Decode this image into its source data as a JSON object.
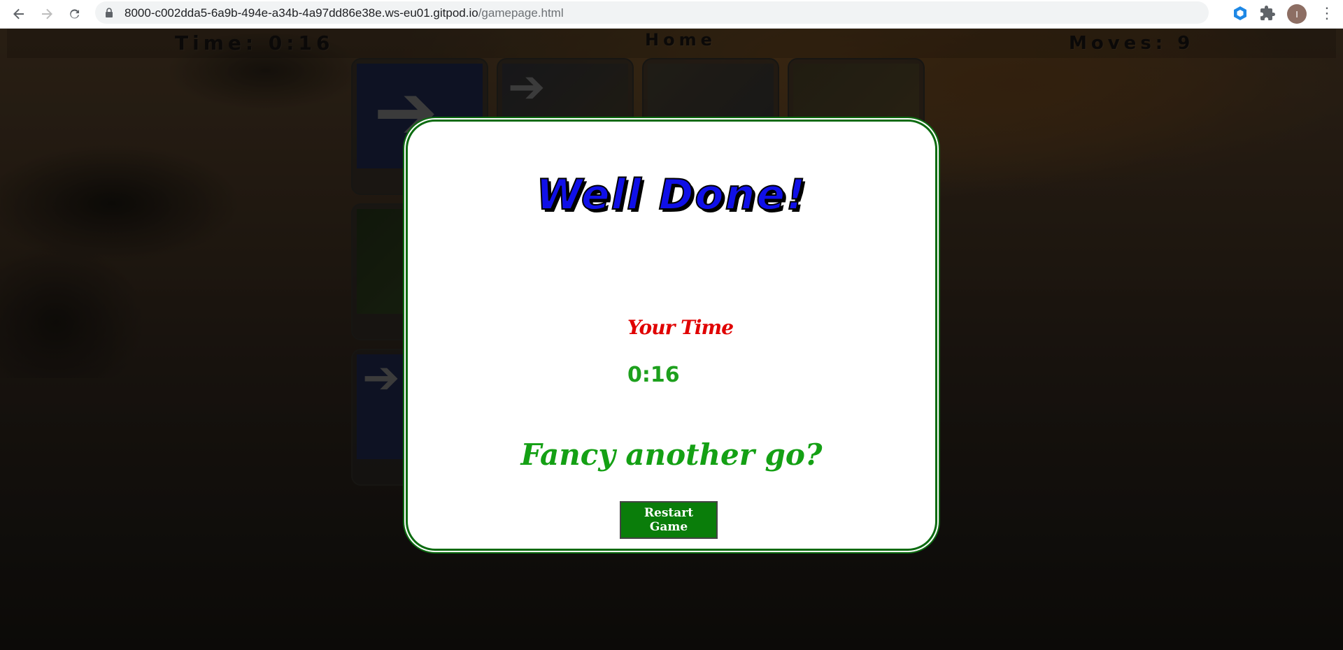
{
  "browser": {
    "url_host": "8000-c002dda5-6a9b-494e-a34b-4a97dd86e38e.ws-eu01.gitpod.io",
    "url_path": "/gamepage.html",
    "avatar_letter": "I",
    "icons": {
      "back": "arrow-left-icon",
      "forward": "arrow-right-icon",
      "reload": "reload-icon",
      "lock": "lock-icon",
      "bookmark": "star-icon",
      "extension": "hexagon-extension-icon",
      "extensions_menu": "puzzle-icon",
      "menu": "more-vert-icon"
    }
  },
  "game": {
    "time_label": "Time: 0:16",
    "home_label": "Home",
    "moves_label": "Moves: 9"
  },
  "modal": {
    "title": "Well Done!",
    "your_time_label": "Your Time",
    "time_value": "0:16",
    "prompt": "Fancy another go?",
    "restart_label": "Restart Game"
  },
  "colors": {
    "modal_border": "#0c6b10",
    "title": "#1010e8",
    "your_time": "#e00000",
    "time_value": "#1da01d",
    "button": "#0a7d0a"
  }
}
